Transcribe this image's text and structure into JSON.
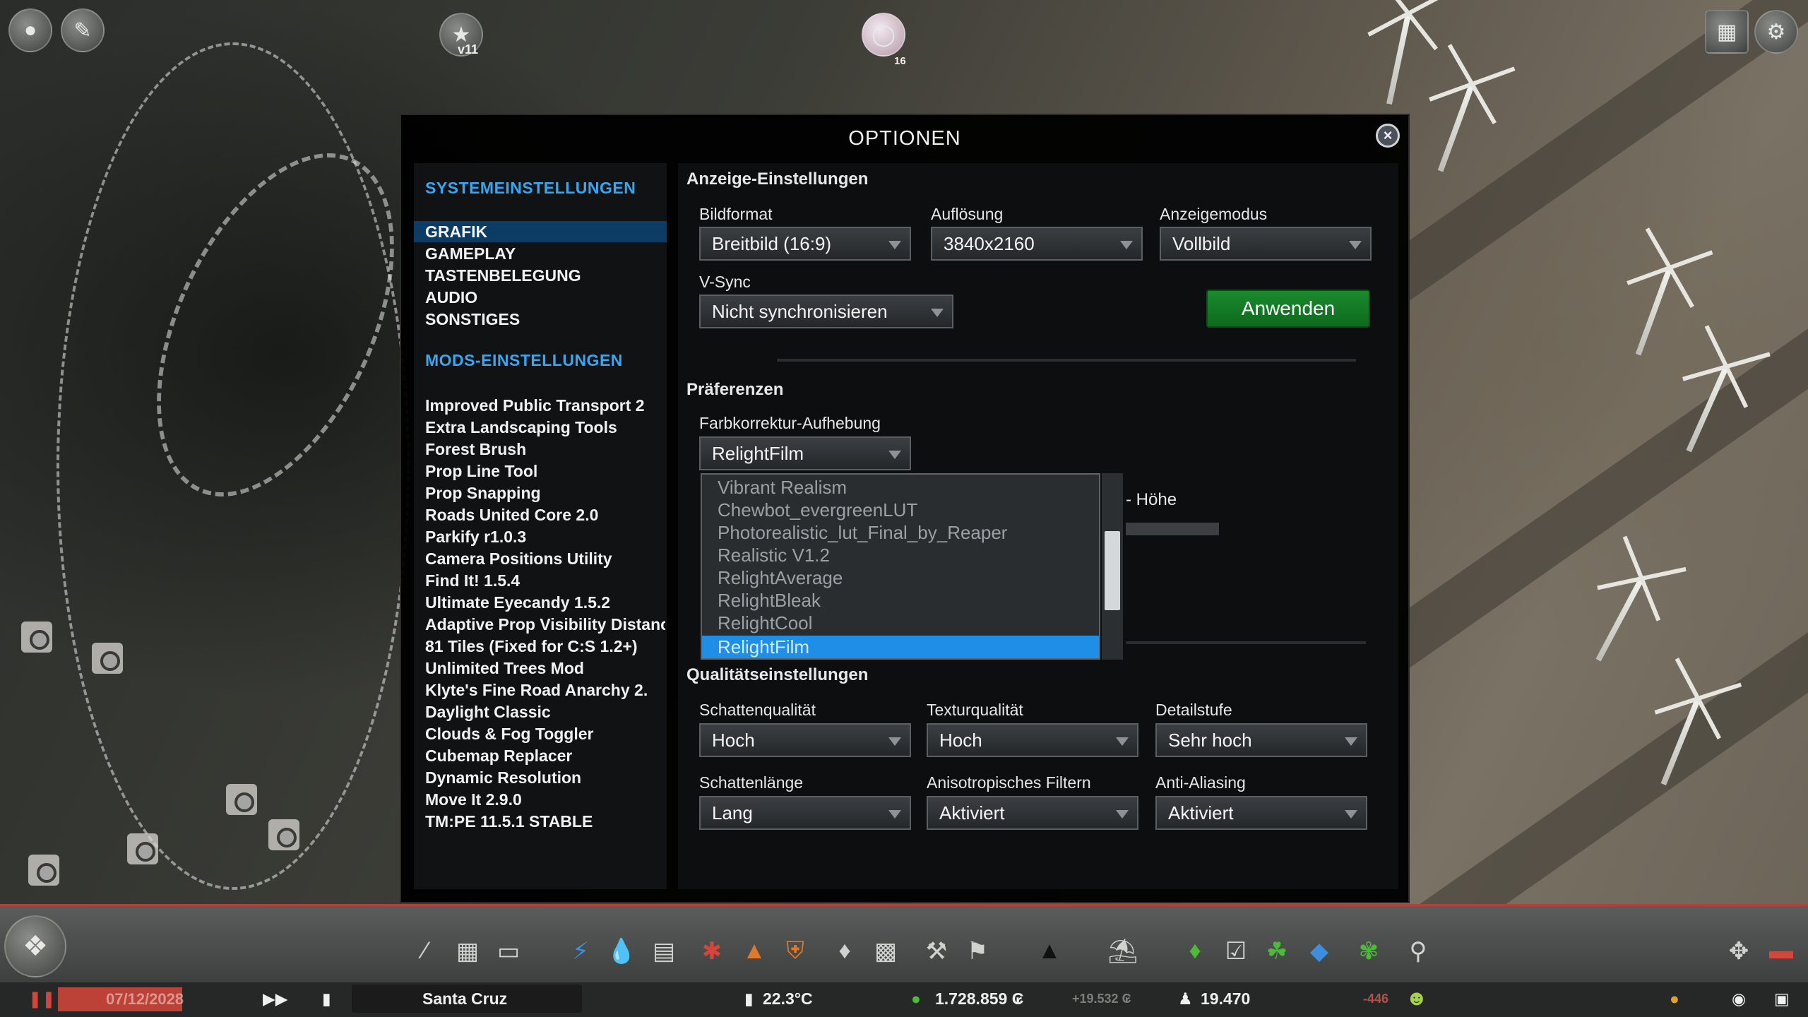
{
  "dialog": {
    "title": "OPTIONEN",
    "close_glyph": "×"
  },
  "sidebar": {
    "system_heading": "SYSTEMEINSTELLUNGEN",
    "system_items": [
      "GRAFIK",
      "GAMEPLAY",
      "TASTENBELEGUNG",
      "AUDIO",
      "SONSTIGES"
    ],
    "active_item": "GRAFIK",
    "mods_heading": "MODS-EINSTELLUNGEN",
    "mod_items": [
      "Improved Public Transport 2",
      "Extra Landscaping Tools",
      "Forest Brush",
      "Prop Line Tool",
      "Prop Snapping",
      "Roads United Core 2.0",
      "Parkify r1.0.3",
      "Camera Positions Utility",
      "Find It! 1.5.4",
      "Ultimate Eyecandy 1.5.2",
      "Adaptive Prop Visibility Distance",
      "81 Tiles (Fixed for C:S 1.2+)",
      "Unlimited Trees Mod",
      "Klyte's Fine Road Anarchy 2.",
      "Daylight Classic",
      "Clouds & Fog Toggler",
      "Cubemap Replacer",
      "Dynamic Resolution",
      "Move It 2.9.0",
      "TM:PE 11.5.1 STABLE"
    ]
  },
  "display": {
    "section_title": "Anzeige-Einstellungen",
    "aspect": {
      "label": "Bildformat",
      "value": "Breitbild (16:9)"
    },
    "resolution": {
      "label": "Auflösung",
      "value": "3840x2160"
    },
    "mode": {
      "label": "Anzeigemodus",
      "value": "Vollbild"
    },
    "vsync": {
      "label": "V-Sync",
      "value": "Nicht synchronisieren"
    },
    "apply_label": "Anwenden"
  },
  "preferences": {
    "section_title": "Präferenzen",
    "lut": {
      "label": "Farbkorrektur-Aufhebung",
      "value": "RelightFilm"
    },
    "lut_options": [
      "Vibrant Realism",
      "Chewbot_evergreenLUT",
      "Photorealistic_lut_Final_by_Reaper",
      "Realistic V1.2",
      "RelightAverage",
      "RelightBleak",
      "RelightCool",
      "RelightFilm"
    ],
    "selected_option": "RelightFilm",
    "partially_hidden_label": "- Höhe"
  },
  "quality": {
    "section_title": "Qualitätseinstellungen",
    "shadow_quality": {
      "label": "Schattenqualität",
      "value": "Hoch"
    },
    "texture_quality": {
      "label": "Texturqualität",
      "value": "Hoch"
    },
    "detail_level": {
      "label": "Detailstufe",
      "value": "Sehr hoch"
    },
    "shadow_length": {
      "label": "Schattenlänge",
      "value": "Lang"
    },
    "anisotropic": {
      "label": "Anisotropisches Filtern",
      "value": "Aktiviert"
    },
    "antialiasing": {
      "label": "Anti-Aliasing",
      "value": "Aktiviert"
    }
  },
  "hud": {
    "version_badge": "v11",
    "pop_badge": "16",
    "date": "07/12/2028",
    "city_name": "Santa Cruz",
    "temperature": "22.3°C",
    "money": "1.728.859 ₢",
    "income": "+19.532 ₢",
    "population": "19.470",
    "population_delta": "-446"
  },
  "colors": {
    "accent_blue": "#3aa6f0",
    "apply_green": "#1a8a2c",
    "selected_highlight": "#1e8ee6",
    "active_nav": "#0c3b63"
  }
}
